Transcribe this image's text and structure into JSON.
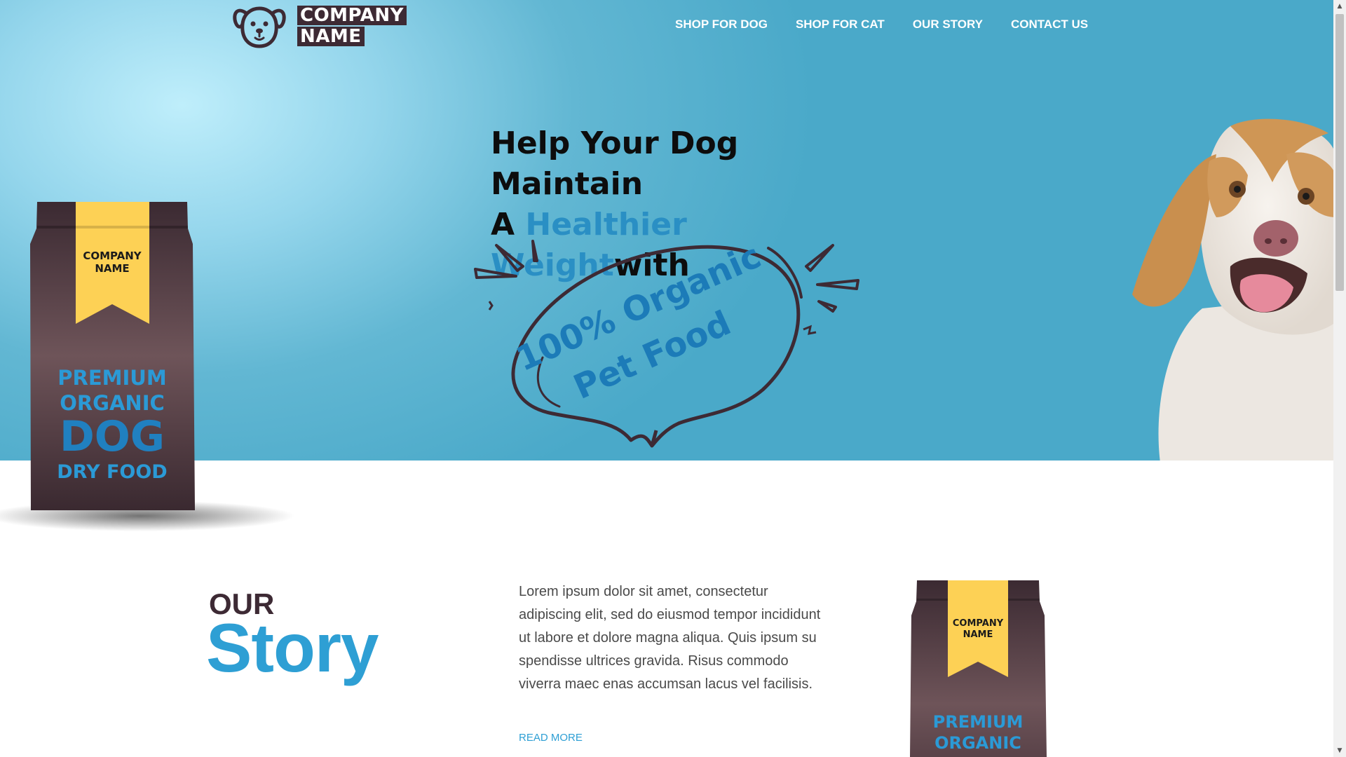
{
  "brand": {
    "line1": "COMPANY",
    "line2": "NAME"
  },
  "nav": {
    "items": [
      {
        "label": "SHOP FOR DOG"
      },
      {
        "label": "SHOP FOR CAT"
      },
      {
        "label": "OUR STORY"
      },
      {
        "label": "CONTACT US"
      }
    ]
  },
  "hero": {
    "line1": "Help Your Dog Maintain",
    "line2_prefix": "A ",
    "line2_accent": "Healthier Weight",
    "line2_suffix": "with",
    "bubble_line1": "100% Organic",
    "bubble_line2": "Pet Food"
  },
  "bag_large": {
    "brand_line1": "COMPANY",
    "brand_line2": "NAME",
    "line1": "PREMIUM",
    "line2": "ORGANIC",
    "line3": "DOG",
    "line4": "DRY FOOD"
  },
  "bag_small": {
    "brand_line1": "COMPANY",
    "brand_line2": "NAME",
    "line1": "PREMIUM",
    "line2": "ORGANIC"
  },
  "story": {
    "heading_small": "OUR",
    "heading_big": "Story",
    "body": "Lorem ipsum dolor sit amet, consectetur adipiscing elit, sed do eiusmod tempor incididunt ut labore et dolore magna aliqua. Quis ipsum su spendisse ultrices gravida. Risus commodo viverra maec enas accumsan lacus vel facilisis.",
    "read_more": "READ MORE"
  },
  "colors": {
    "brand_dark": "#3d2a34",
    "accent_blue": "#2e9fd4",
    "ribbon_yellow": "#fdd155",
    "hero_blue": "#4aa9c9"
  },
  "icons": {
    "logo": "dog-face-icon",
    "scroll_up": "arrow-up-icon",
    "scroll_down": "arrow-down-icon"
  }
}
